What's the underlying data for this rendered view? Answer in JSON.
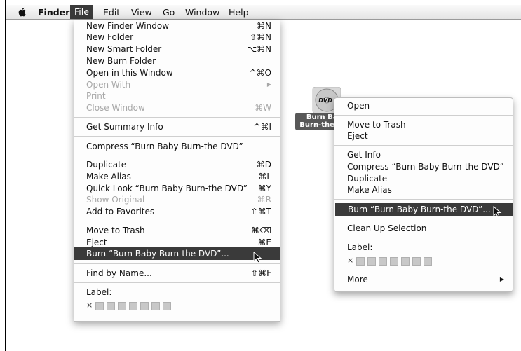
{
  "menubar": {
    "items": [
      "Finder",
      "File",
      "Edit",
      "View",
      "Go",
      "Window",
      "Help"
    ]
  },
  "file_menu": {
    "items": [
      {
        "label": "New Finder Window",
        "shortcut": "⌘N"
      },
      {
        "label": "New Folder",
        "shortcut": "⇧⌘N"
      },
      {
        "label": "New Smart Folder",
        "shortcut": "⌥⌘N"
      },
      {
        "label": "New Burn Folder",
        "shortcut": ""
      },
      {
        "label": "Open in this Window",
        "shortcut": "^⌘O"
      },
      {
        "label": "Open With",
        "shortcut": "▶"
      },
      {
        "label": "Print",
        "shortcut": ""
      },
      {
        "label": "Close Window",
        "shortcut": "⌘W"
      },
      {
        "label": "Get Summary Info",
        "shortcut": "^⌘I"
      },
      {
        "label": "Compress “Burn Baby Burn-the DVD”",
        "shortcut": ""
      },
      {
        "label": "Duplicate",
        "shortcut": "⌘D"
      },
      {
        "label": "Make Alias",
        "shortcut": "⌘L"
      },
      {
        "label": "Quick Look “Burn Baby Burn-the DVD”",
        "shortcut": "⌘Y"
      },
      {
        "label": "Show Original",
        "shortcut": "⌘R"
      },
      {
        "label": "Add to Favorites",
        "shortcut": "⇧⌘T"
      },
      {
        "label": "Move to Trash",
        "shortcut": "⌘⌫"
      },
      {
        "label": "Eject",
        "shortcut": "⌘E"
      },
      {
        "label": "Burn “Burn Baby Burn-the DVD”...",
        "shortcut": ""
      },
      {
        "label": "Find by Name...",
        "shortcut": "⇧⌘F"
      },
      {
        "label": "Label:",
        "shortcut": ""
      }
    ],
    "label_clear": "×"
  },
  "desktop_icon": {
    "badge": "DVD",
    "label_line1": "Burn Baby",
    "label_line2": "Burn-the DVD"
  },
  "context_menu": {
    "items": [
      {
        "label": "Open"
      },
      {
        "label": "Move to Trash"
      },
      {
        "label": "Eject"
      },
      {
        "label": "Get Info"
      },
      {
        "label": "Compress “Burn Baby Burn-the DVD”"
      },
      {
        "label": "Duplicate"
      },
      {
        "label": "Make Alias"
      },
      {
        "label": "Burn “Burn Baby Burn-the DVD”..."
      },
      {
        "label": "Clean Up Selection"
      },
      {
        "label": "Label:"
      },
      {
        "label": "More",
        "submenu_arrow": "▶"
      }
    ],
    "label_clear": "×"
  },
  "colors": {
    "highlight": "#3a3a3a",
    "disabled_text": "#a8a8a8",
    "label_swatch": "#c8c8c8"
  }
}
